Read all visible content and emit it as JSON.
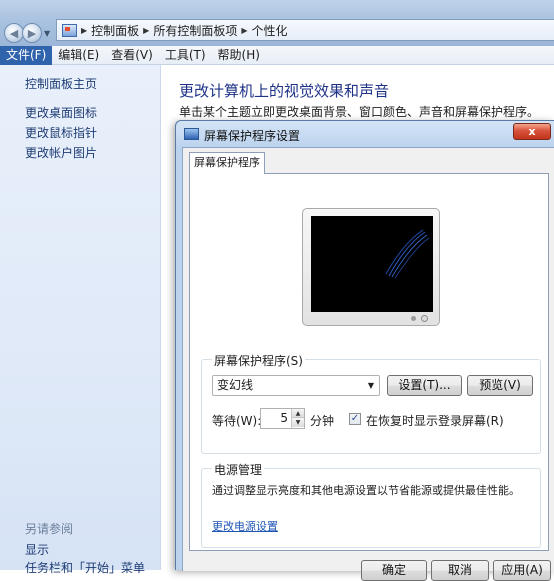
{
  "address": {
    "crumbs": [
      "控制面板",
      "所有控制面板项",
      "个性化"
    ]
  },
  "menu": {
    "items": [
      "文件(F)",
      "编辑(E)",
      "查看(V)",
      "工具(T)",
      "帮助(H)"
    ]
  },
  "left_pane": {
    "home": "控制面板主页",
    "links": [
      "更改桌面图标",
      "更改鼠标指针",
      "更改帐户图片"
    ],
    "see_also": "另请参阅",
    "see_also_links": [
      "显示",
      "任务栏和「开始」菜单"
    ]
  },
  "content": {
    "title": "更改计算机上的视觉效果和声音",
    "description": "单击某个主题立即更改桌面背景、窗口颜色、声音和屏幕保护程序。"
  },
  "dialog": {
    "title": "屏幕保护程序设置",
    "close": "x",
    "tab": "屏幕保护程序",
    "screensaver_group": "屏幕保护程序(S)",
    "selected_screensaver": "变幻线",
    "settings_button": "设置(T)...",
    "preview_button": "预览(V)",
    "wait_label": "等待(W):",
    "wait_value": "5",
    "minutes_label": "分钟",
    "resume_checked": true,
    "resume_label": "在恢复时显示登录屏幕(R)",
    "power_group": "电源管理",
    "power_description": "通过调整显示亮度和其他电源设置以节省能源或提供最佳性能。",
    "power_link": "更改电源设置",
    "ok": "确定",
    "cancel": "取消",
    "apply": "应用(A)"
  },
  "colors": {
    "title_link": "#1e3287",
    "link": "#1e56b5",
    "close_button": "#c0351c",
    "active_menu": "#2f63ac"
  }
}
